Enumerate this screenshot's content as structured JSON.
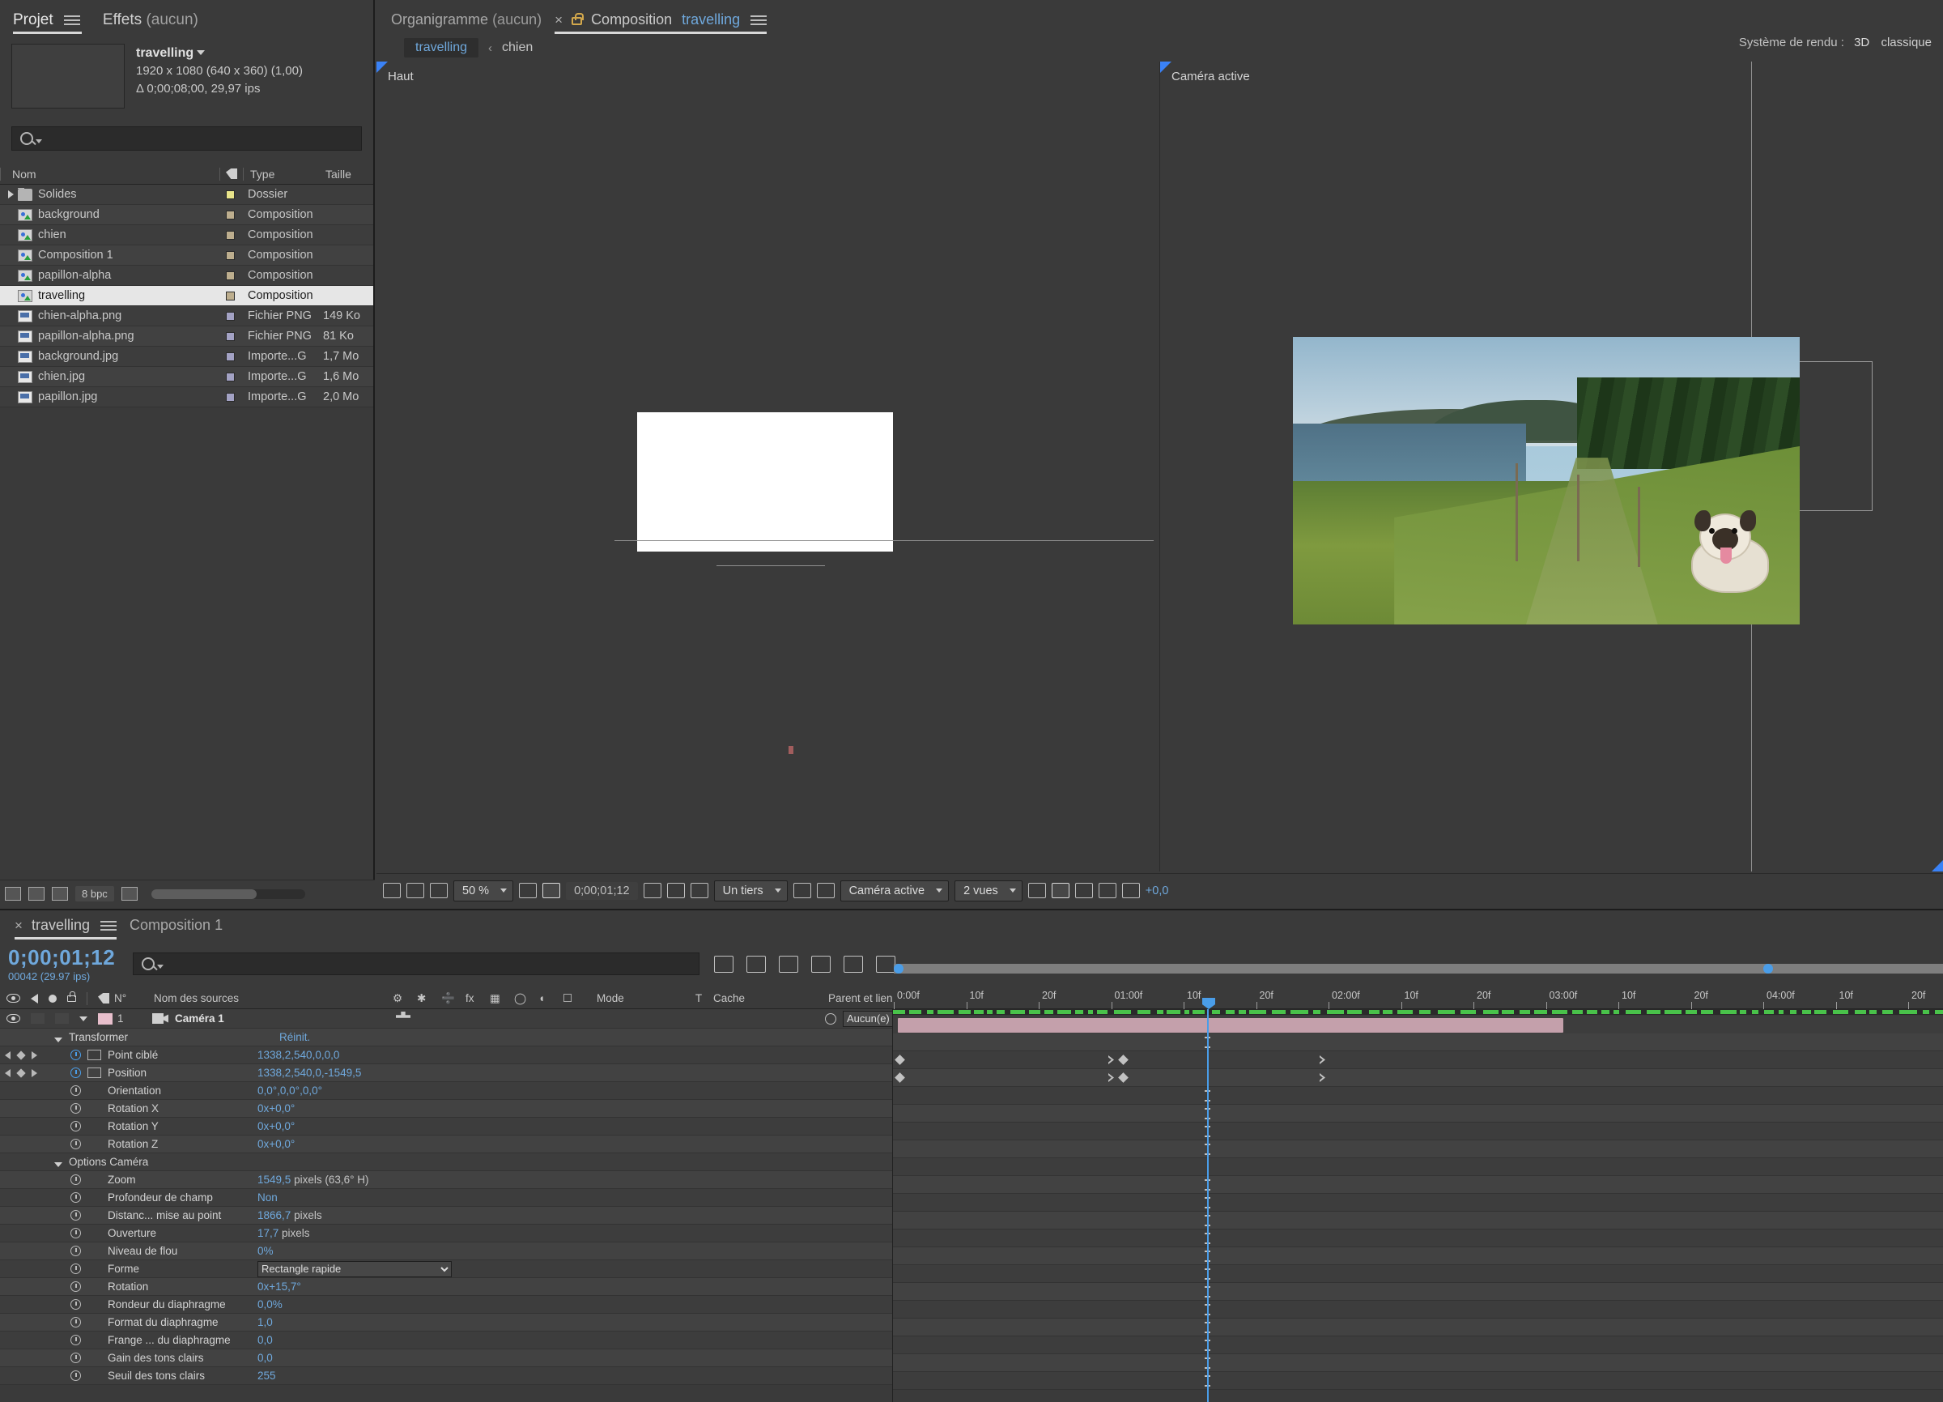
{
  "project": {
    "tabs": [
      {
        "label": "Projet",
        "active": true
      },
      {
        "label": "Effets",
        "suffix": "(aucun)",
        "active": false
      }
    ],
    "preview": {
      "name": "travelling",
      "dimensions": "1920 x 1080  (640 x 360) (1,00)",
      "duration": "Δ 0;00;08;00, 29,97 ips"
    },
    "search_placeholder": "",
    "columns": {
      "name": "Nom",
      "type": "Type",
      "size": "Taille"
    },
    "items": [
      {
        "name": "Solides",
        "type": "Dossier",
        "size": "",
        "icon": "folder-icon",
        "swatch": "#e8e48a",
        "expandable": true,
        "selected": false
      },
      {
        "name": "background",
        "type": "Composition",
        "size": "",
        "icon": "composition-icon",
        "swatch": "#bdae8e",
        "expandable": false,
        "selected": false
      },
      {
        "name": "chien",
        "type": "Composition",
        "size": "",
        "icon": "composition-icon",
        "swatch": "#bdae8e",
        "expandable": false,
        "selected": false
      },
      {
        "name": "Composition 1",
        "type": "Composition",
        "size": "",
        "icon": "composition-icon",
        "swatch": "#bdae8e",
        "expandable": false,
        "selected": false
      },
      {
        "name": "papillon-alpha",
        "type": "Composition",
        "size": "",
        "icon": "composition-icon",
        "swatch": "#bdae8e",
        "expandable": false,
        "selected": false
      },
      {
        "name": "travelling",
        "type": "Composition",
        "size": "",
        "icon": "composition-icon",
        "swatch": "#bdae8e",
        "expandable": false,
        "selected": true
      },
      {
        "name": "chien-alpha.png",
        "type": "Fichier PNG",
        "size": "149 Ko",
        "icon": "png-file-icon",
        "swatch": "#a3a2c4",
        "expandable": false,
        "selected": false
      },
      {
        "name": "papillon-alpha.png",
        "type": "Fichier PNG",
        "size": "81 Ko",
        "icon": "png-file-icon",
        "swatch": "#a3a2c4",
        "expandable": false,
        "selected": false
      },
      {
        "name": "background.jpg",
        "type": "Importe...G",
        "size": "1,7 Mo",
        "icon": "jpeg-file-icon",
        "swatch": "#a3a2c4",
        "expandable": false,
        "selected": false
      },
      {
        "name": "chien.jpg",
        "type": "Importe...G",
        "size": "1,6 Mo",
        "icon": "jpeg-file-icon",
        "swatch": "#a3a2c4",
        "expandable": false,
        "selected": false
      },
      {
        "name": "papillon.jpg",
        "type": "Importe...G",
        "size": "2,0 Mo",
        "icon": "jpeg-file-icon",
        "swatch": "#a3a2c4",
        "expandable": false,
        "selected": false
      }
    ],
    "footer": {
      "bit_depth": "8 bpc"
    }
  },
  "viewer": {
    "tabs": [
      {
        "label": "Organigramme",
        "suffix": "(aucun)",
        "active": false
      },
      {
        "label": "Composition",
        "name": "travelling",
        "active": true
      }
    ],
    "breadcrumb": {
      "current": "travelling",
      "parent": "chien"
    },
    "render_system": {
      "label": "Système de rendu :",
      "value": "3D",
      "mode": "classique"
    },
    "panes": [
      {
        "label": "Haut"
      },
      {
        "label": "Caméra active"
      }
    ],
    "toolbar": {
      "zoom": "50 %",
      "timecode": "0;00;01;12",
      "resolution": "Un tiers",
      "view_camera": "Caméra active",
      "view_layout": "2 vues",
      "exposure": "+0,0"
    }
  },
  "timeline": {
    "tabs": [
      {
        "label": "travelling",
        "active": true
      },
      {
        "label": "Composition 1",
        "active": false
      }
    ],
    "current_time": "0;00;01;12",
    "frame_info": "00042 (29.97 ips)",
    "columns": {
      "number": "N°",
      "source_name": "Nom des sources",
      "mode": "Mode",
      "track_matte": "T",
      "cache": "Cache",
      "parent": "Parent et lien"
    },
    "layer": {
      "index": "1",
      "name": "Caméra 1",
      "parent_value": "Aucun(e)",
      "label_color": "#e8bfcc"
    },
    "groups": [
      {
        "name": "Transformer",
        "value": "Réinit."
      },
      {
        "name": "Options Caméra",
        "value": ""
      }
    ],
    "properties": [
      {
        "name": "Point ciblé",
        "value": "1338,2,540,0,0,0",
        "unit": "",
        "animated": true,
        "graph": true,
        "keyframes": true
      },
      {
        "name": "Position",
        "value": "1338,2,540,0,-1549,5",
        "unit": "",
        "animated": true,
        "graph": true,
        "keyframes": true
      },
      {
        "name": "Orientation",
        "value": "0,0°,0,0°,0,0°",
        "unit": "",
        "animated": false,
        "graph": false,
        "keyframes": false
      },
      {
        "name": "Rotation X",
        "value": "0x+0,0°",
        "unit": "",
        "animated": false,
        "graph": false,
        "keyframes": false
      },
      {
        "name": "Rotation Y",
        "value": "0x+0,0°",
        "unit": "",
        "animated": false,
        "graph": false,
        "keyframes": false
      },
      {
        "name": "Rotation Z",
        "value": "0x+0,0°",
        "unit": "",
        "animated": false,
        "graph": false,
        "keyframes": false
      },
      {
        "name": "Zoom",
        "value": "1549,5",
        "unit": "pixels (63,6° H)",
        "animated": false,
        "graph": false,
        "keyframes": false
      },
      {
        "name": "Profondeur de champ",
        "value": "Non",
        "unit": "",
        "animated": false,
        "graph": false,
        "keyframes": false
      },
      {
        "name": "Distanc... mise au point",
        "value": "1866,7",
        "unit": "pixels",
        "animated": false,
        "graph": false,
        "keyframes": false
      },
      {
        "name": "Ouverture",
        "value": "17,7",
        "unit": "pixels",
        "animated": false,
        "graph": false,
        "keyframes": false
      },
      {
        "name": "Niveau de flou",
        "value": "0%",
        "unit": "",
        "animated": false,
        "graph": false,
        "keyframes": false
      },
      {
        "name": "Forme",
        "value": "Rectangle rapide",
        "unit": "",
        "animated": false,
        "graph": false,
        "keyframes": false,
        "dropdown": true
      },
      {
        "name": "Rotation",
        "value": "0x+15,7°",
        "unit": "",
        "animated": false,
        "graph": false,
        "keyframes": false
      },
      {
        "name": "Rondeur du diaphragme",
        "value": "0,0%",
        "unit": "",
        "animated": false,
        "graph": false,
        "keyframes": false
      },
      {
        "name": "Format du diaphragme",
        "value": "1,0",
        "unit": "",
        "animated": false,
        "graph": false,
        "keyframes": false
      },
      {
        "name": "Frange ... du diaphragme",
        "value": "0,0",
        "unit": "",
        "animated": false,
        "graph": false,
        "keyframes": false
      },
      {
        "name": "Gain des tons clairs",
        "value": "0,0",
        "unit": "",
        "animated": false,
        "graph": false,
        "keyframes": false
      },
      {
        "name": "Seuil des tons clairs",
        "value": "255",
        "unit": "",
        "animated": false,
        "graph": false,
        "keyframes": false
      }
    ],
    "ruler_labels": [
      "0:00f",
      "10f",
      "20f",
      "01:00f",
      "10f",
      "20f",
      "02:00f",
      "10f",
      "20f",
      "03:00f",
      "10f",
      "20f",
      "04:00f",
      "10f",
      "20f"
    ]
  }
}
